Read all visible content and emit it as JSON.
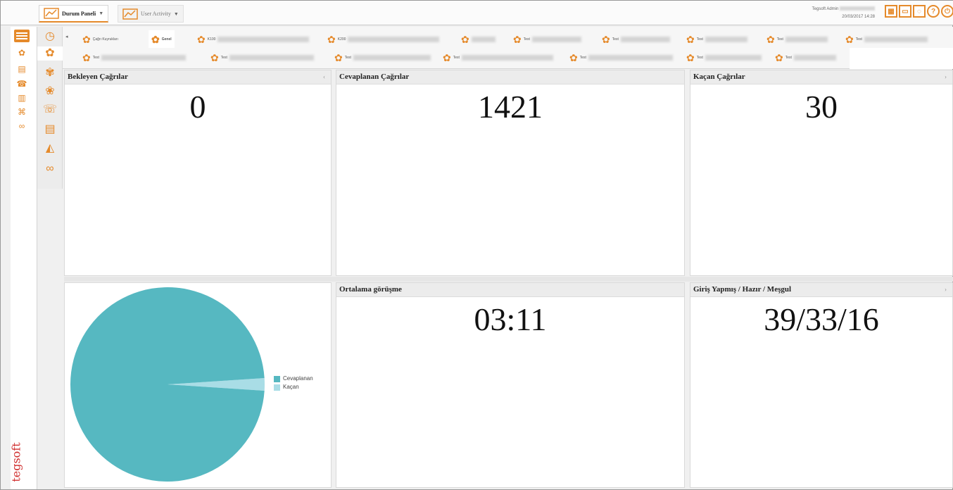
{
  "top_tabs": [
    {
      "label": "Durum Paneli",
      "caret": "▼"
    },
    {
      "label": "User Activity",
      "caret": "▼"
    }
  ],
  "user": {
    "name": "Tegsoft Admin",
    "datetime": "20/03/2017 14:28"
  },
  "brand": {
    "logo": "tegsoft"
  },
  "subtabs": [
    {
      "label": "Çağrı Kuyrukları"
    },
    {
      "label": "Genel"
    },
    {
      "label": "K100"
    },
    {
      "label": "K200"
    },
    {
      "label": "Test"
    },
    {
      "label": "Test"
    },
    {
      "label": "Test"
    },
    {
      "label": "Test"
    },
    {
      "label": "Test"
    },
    {
      "label": "Test"
    },
    {
      "label": "Test"
    },
    {
      "label": "Test"
    },
    {
      "label": "Test"
    },
    {
      "label": "Test"
    },
    {
      "label": "Test"
    },
    {
      "label": "Test"
    }
  ],
  "panels": {
    "waiting": {
      "title": "Bekleyen Çağrılar",
      "value": "0"
    },
    "answered": {
      "title": "Cevaplanan Çağrılar",
      "value": "1421"
    },
    "missed": {
      "title": "Kaçan Çağrılar",
      "value": "30"
    },
    "avg_talk": {
      "title": "Ortalama görüşme",
      "value": "03:11"
    },
    "agents": {
      "title": "Giriş Yapmış / Hazır / Meşgul",
      "value": "39/33/16"
    }
  },
  "chart_data": {
    "type": "pie",
    "categories": [
      "Cevaplanan",
      "Kaçan"
    ],
    "values": [
      1421,
      30
    ],
    "colors": [
      "#56b8c1",
      "#a9dde6"
    ],
    "legend_position": "right"
  },
  "colors": {
    "accent": "#e58a2b",
    "pie_main": "#56b8c1",
    "pie_slice": "#a9dde6",
    "brand": "#d02f2f"
  }
}
